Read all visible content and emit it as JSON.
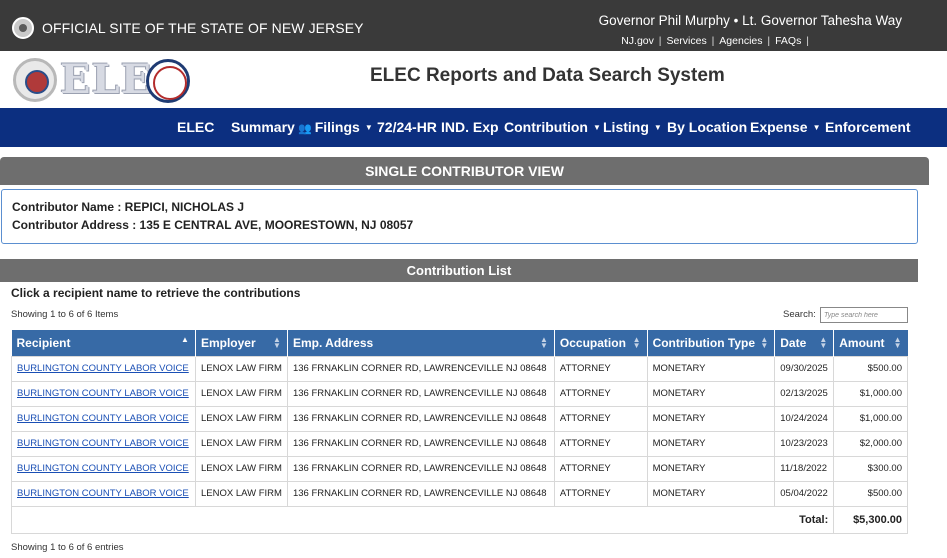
{
  "topbar": {
    "official": "OFFICIAL SITE OF THE STATE OF NEW JERSEY",
    "governor": "Governor Phil Murphy • Lt. Governor Tahesha Way",
    "links": [
      "NJ.gov",
      "Services",
      "Agencies",
      "FAQs"
    ]
  },
  "logo": {
    "text": "ELEC"
  },
  "app_title": "ELEC Reports and Data Search System",
  "nav": {
    "items": [
      {
        "label": "ELEC"
      },
      {
        "label": "Summary"
      },
      {
        "label": "Filings",
        "icon": "people-icon",
        "caret": true
      },
      {
        "label": "72/24-HR"
      },
      {
        "label": "IND. Exp"
      },
      {
        "label": "Contribution",
        "caret": true
      },
      {
        "label": "Listing",
        "caret": true
      },
      {
        "label": "By Location"
      },
      {
        "label": "Expense",
        "caret": true
      },
      {
        "label": "Enforcement"
      }
    ]
  },
  "panel_title": "SINGLE CONTRIBUTOR VIEW",
  "contributor": {
    "name_line": "Contributor Name : REPICI, NICHOLAS J",
    "address_line": "Contributor Address : 135 E CENTRAL AVE, MOORESTOWN, NJ 08057"
  },
  "list_title": "Contribution List",
  "hint": "Click a recipient name to retrieve the contributions",
  "showing_top": "Showing 1 to 6 of 6 Items",
  "search": {
    "label": "Search:",
    "placeholder": "Type search here",
    "value": ""
  },
  "table": {
    "columns": [
      "Recipient",
      "Employer",
      "Emp. Address",
      "Occupation",
      "Contribution Type",
      "Date",
      "Amount"
    ],
    "rows": [
      [
        "BURLINGTON COUNTY LABOR VOICE",
        "LENOX LAW FIRM",
        "136 FRNAKLIN CORNER RD, LAWRENCEVILLE NJ 08648",
        "ATTORNEY",
        "MONETARY",
        "09/30/2025",
        "$500.00"
      ],
      [
        "BURLINGTON COUNTY LABOR VOICE",
        "LENOX LAW FIRM",
        "136 FRNAKLIN CORNER RD, LAWRENCEVILLE NJ 08648",
        "ATTORNEY",
        "MONETARY",
        "02/13/2025",
        "$1,000.00"
      ],
      [
        "BURLINGTON COUNTY LABOR VOICE",
        "LENOX LAW FIRM",
        "136 FRNAKLIN CORNER RD, LAWRENCEVILLE NJ 08648",
        "ATTORNEY",
        "MONETARY",
        "10/24/2024",
        "$1,000.00"
      ],
      [
        "BURLINGTON COUNTY LABOR VOICE",
        "LENOX LAW FIRM",
        "136 FRNAKLIN CORNER RD, LAWRENCEVILLE NJ 08648",
        "ATTORNEY",
        "MONETARY",
        "10/23/2023",
        "$2,000.00"
      ],
      [
        "BURLINGTON COUNTY LABOR VOICE",
        "LENOX LAW FIRM",
        "136 FRNAKLIN CORNER RD, LAWRENCEVILLE NJ 08648",
        "ATTORNEY",
        "MONETARY",
        "11/18/2022",
        "$300.00"
      ],
      [
        "BURLINGTON COUNTY LABOR VOICE",
        "LENOX LAW FIRM",
        "136 FRNAKLIN CORNER RD, LAWRENCEVILLE NJ 08648",
        "ATTORNEY",
        "MONETARY",
        "05/04/2022",
        "$500.00"
      ]
    ],
    "total_label": "Total:",
    "total_value": "$5,300.00"
  },
  "showing_bottom": "Showing 1 to 6 of 6 entries",
  "colors": {
    "topbar": "#3a3a3a",
    "nav": "#0c2f80",
    "panel_header": "#6e6e6e",
    "table_header": "#376aa6",
    "link": "#1a4fb5"
  }
}
